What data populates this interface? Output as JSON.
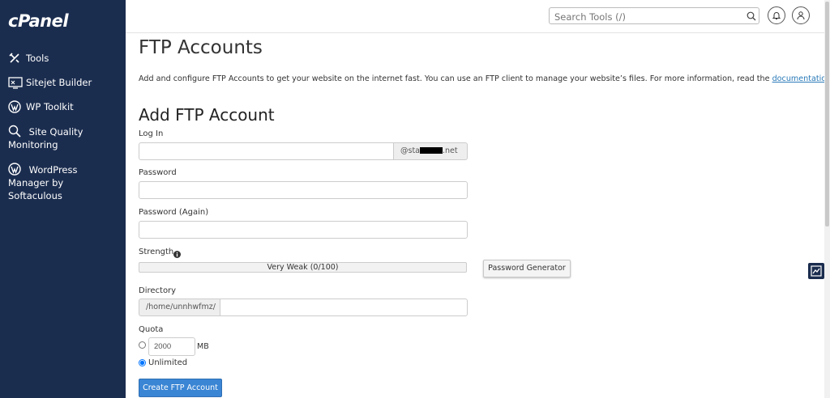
{
  "sidebar": {
    "logo": "cPanel",
    "items": [
      {
        "label": "Tools",
        "icon": "tools-icon"
      },
      {
        "label": "Sitejet Builder",
        "icon": "sitejet-icon"
      },
      {
        "label": "WP Toolkit",
        "icon": "wordpress-icon"
      },
      {
        "label": "Site Quality Monitoring",
        "icon": "magnifier-icon"
      },
      {
        "label": "WordPress Manager by Softaculous",
        "icon": "wordpress-icon"
      }
    ]
  },
  "header": {
    "search_placeholder": "Search Tools (/)"
  },
  "page": {
    "title": "FTP Accounts",
    "intro_text": "Add and configure FTP Accounts to get your website on the internet fast. You can use an FTP client to manage your website’s files. For more information, read the ",
    "intro_link": "documentation",
    "intro_end": "."
  },
  "form": {
    "section_title": "Add FTP Account",
    "login_label": "Log In",
    "login_value": "",
    "domain_prefix": "@sta",
    "domain_suffix": ".net",
    "password_label": "Password",
    "password_again_label": "Password (Again)",
    "strength_label": "Strength",
    "strength_text": "Very Weak (0/100)",
    "password_generator_label": "Password Generator",
    "directory_label": "Directory",
    "directory_prefix": "/home/unnhwfmz/",
    "directory_value": "",
    "quota_label": "Quota",
    "quota_value": "2000",
    "quota_unit": "MB",
    "unlimited_label": "Unlimited",
    "unlimited_selected": true,
    "submit_label": "Create FTP Account"
  },
  "colors": {
    "sidebar_bg": "#1b2d4f",
    "primary_button": "#3a85d4",
    "link": "#2a7ab8"
  }
}
